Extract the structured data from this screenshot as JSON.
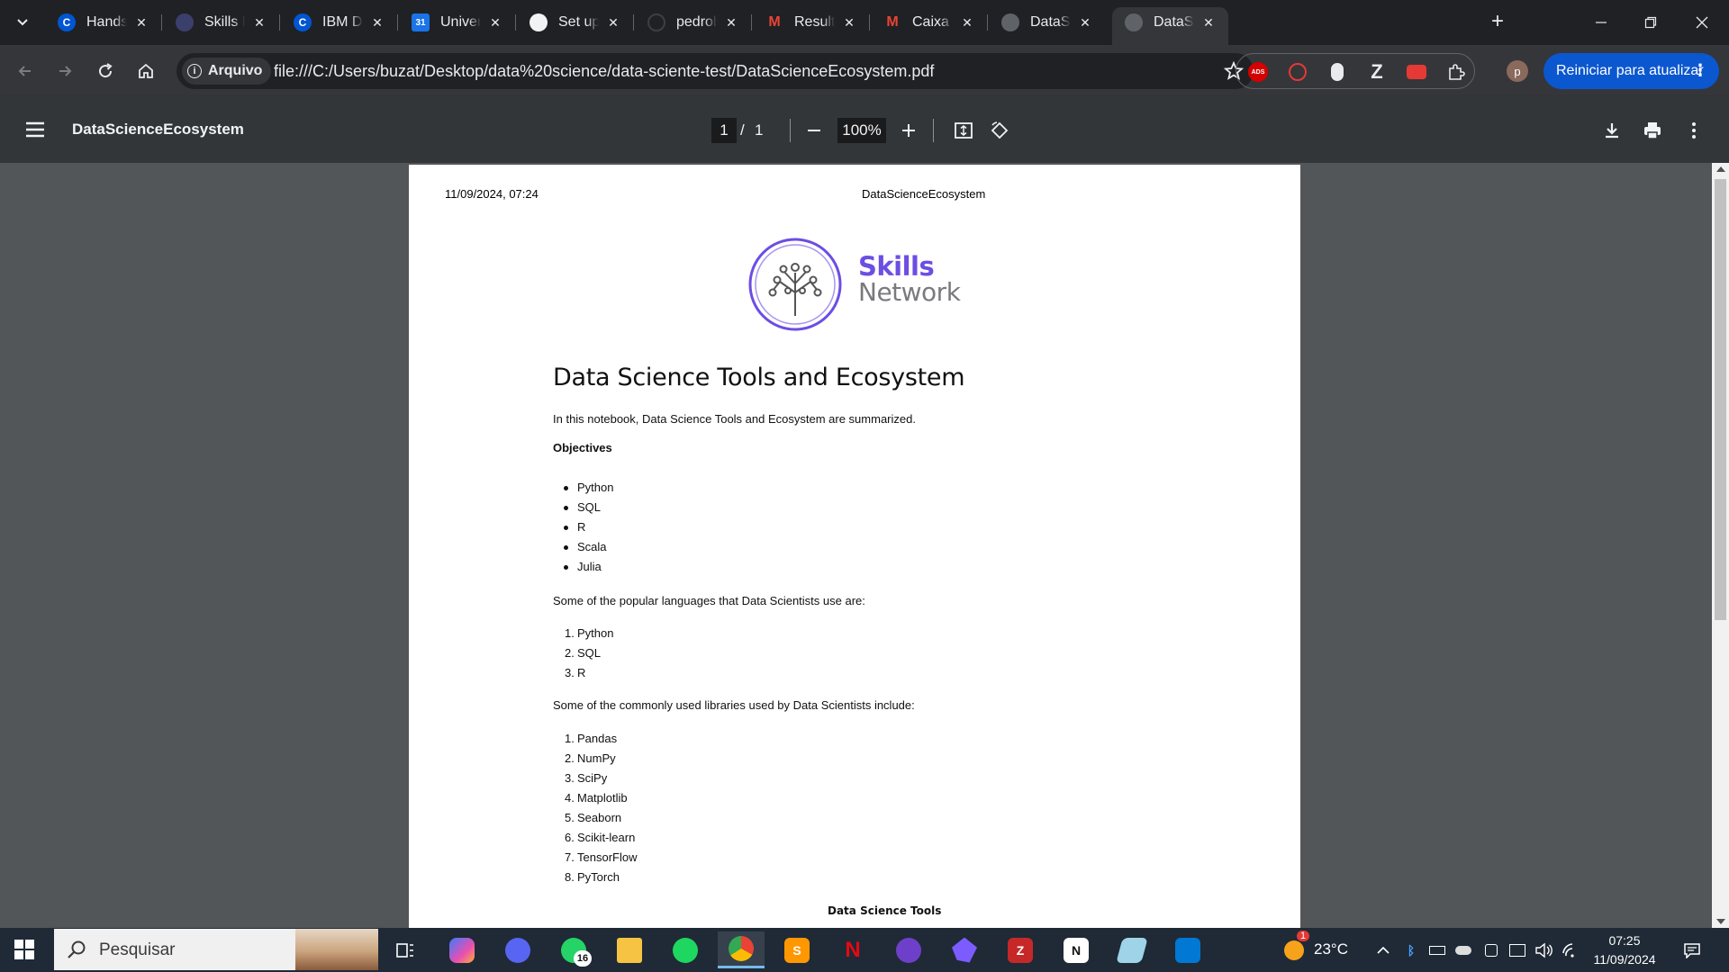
{
  "browser": {
    "tabs": [
      {
        "title": "Hands-on Lab",
        "favicon": "coursera-icon",
        "color": "#0056d2",
        "glyph": "C"
      },
      {
        "title": "Skills Network",
        "favicon": "skills-network-icon",
        "color": "#3b3f6b",
        "glyph": ""
      },
      {
        "title": "IBM Data Science",
        "favicon": "coursera-icon",
        "color": "#0056d2",
        "glyph": "C"
      },
      {
        "title": "Universidade",
        "favicon": "calendar-icon",
        "color": "#1a73e8",
        "glyph": "31"
      },
      {
        "title": "Set up Git",
        "favicon": "github-icon",
        "color": "#f1f3f4",
        "glyph": ""
      },
      {
        "title": "pedrobuzat",
        "favicon": "loading-icon",
        "color": "#202124",
        "glyph": ""
      },
      {
        "title": "Resultados",
        "favicon": "gmail-icon",
        "color": "#ea4335",
        "glyph": "M"
      },
      {
        "title": "Caixa de entrada",
        "favicon": "gmail-icon",
        "color": "#ea4335",
        "glyph": "M"
      },
      {
        "title": "DataScienceEcosystem",
        "favicon": "globe-icon",
        "color": "#5f6368",
        "glyph": ""
      },
      {
        "title": "DataScienceEcosystem",
        "favicon": "globe-icon",
        "color": "#5f6368",
        "glyph": ""
      }
    ],
    "active_tab_index": 9,
    "address": {
      "chip_label": "Arquivo",
      "url": "file:///C:/Users/buzat/Desktop/data%20science/data-sciente-test/DataScienceEcosystem.pdf"
    },
    "profile_initial": "p",
    "update_label": "Reiniciar para atualizar"
  },
  "pdf_viewer": {
    "title": "DataScienceEcosystem",
    "page_current": "1",
    "page_separator": "/",
    "page_total": "1",
    "zoom": "100%"
  },
  "document": {
    "print_date": "11/09/2024, 07:24",
    "print_header": "DataScienceEcosystem",
    "logo_line1": "Skills",
    "logo_line2": "Network",
    "heading": "Data Science Tools and Ecosystem",
    "intro": "In this notebook, Data Science Tools and Ecosystem are summarized.",
    "objectives_label": "Objectives",
    "objectives": [
      "Python",
      "SQL",
      "R",
      "Scala",
      "Julia"
    ],
    "languages_intro": "Some of the popular languages that Data Scientists use are:",
    "languages": [
      "Python",
      "SQL",
      "R"
    ],
    "libraries_intro": "Some of the commonly used libraries used by Data Scientists include:",
    "libraries": [
      "Pandas",
      "NumPy",
      "SciPy",
      "Matplotlib",
      "Seaborn",
      "Scikit-learn",
      "TensorFlow",
      "PyTorch"
    ],
    "tools_caption": "Data Science Tools"
  },
  "taskbar": {
    "search_placeholder": "Pesquisar",
    "whatsapp_badge": "16",
    "weather_temp": "23°C",
    "weather_badge": "1",
    "time": "07:25",
    "date": "11/09/2024"
  },
  "colors": {
    "brand_purple": "#6c4ee3",
    "update_blue": "#0b57d0"
  }
}
